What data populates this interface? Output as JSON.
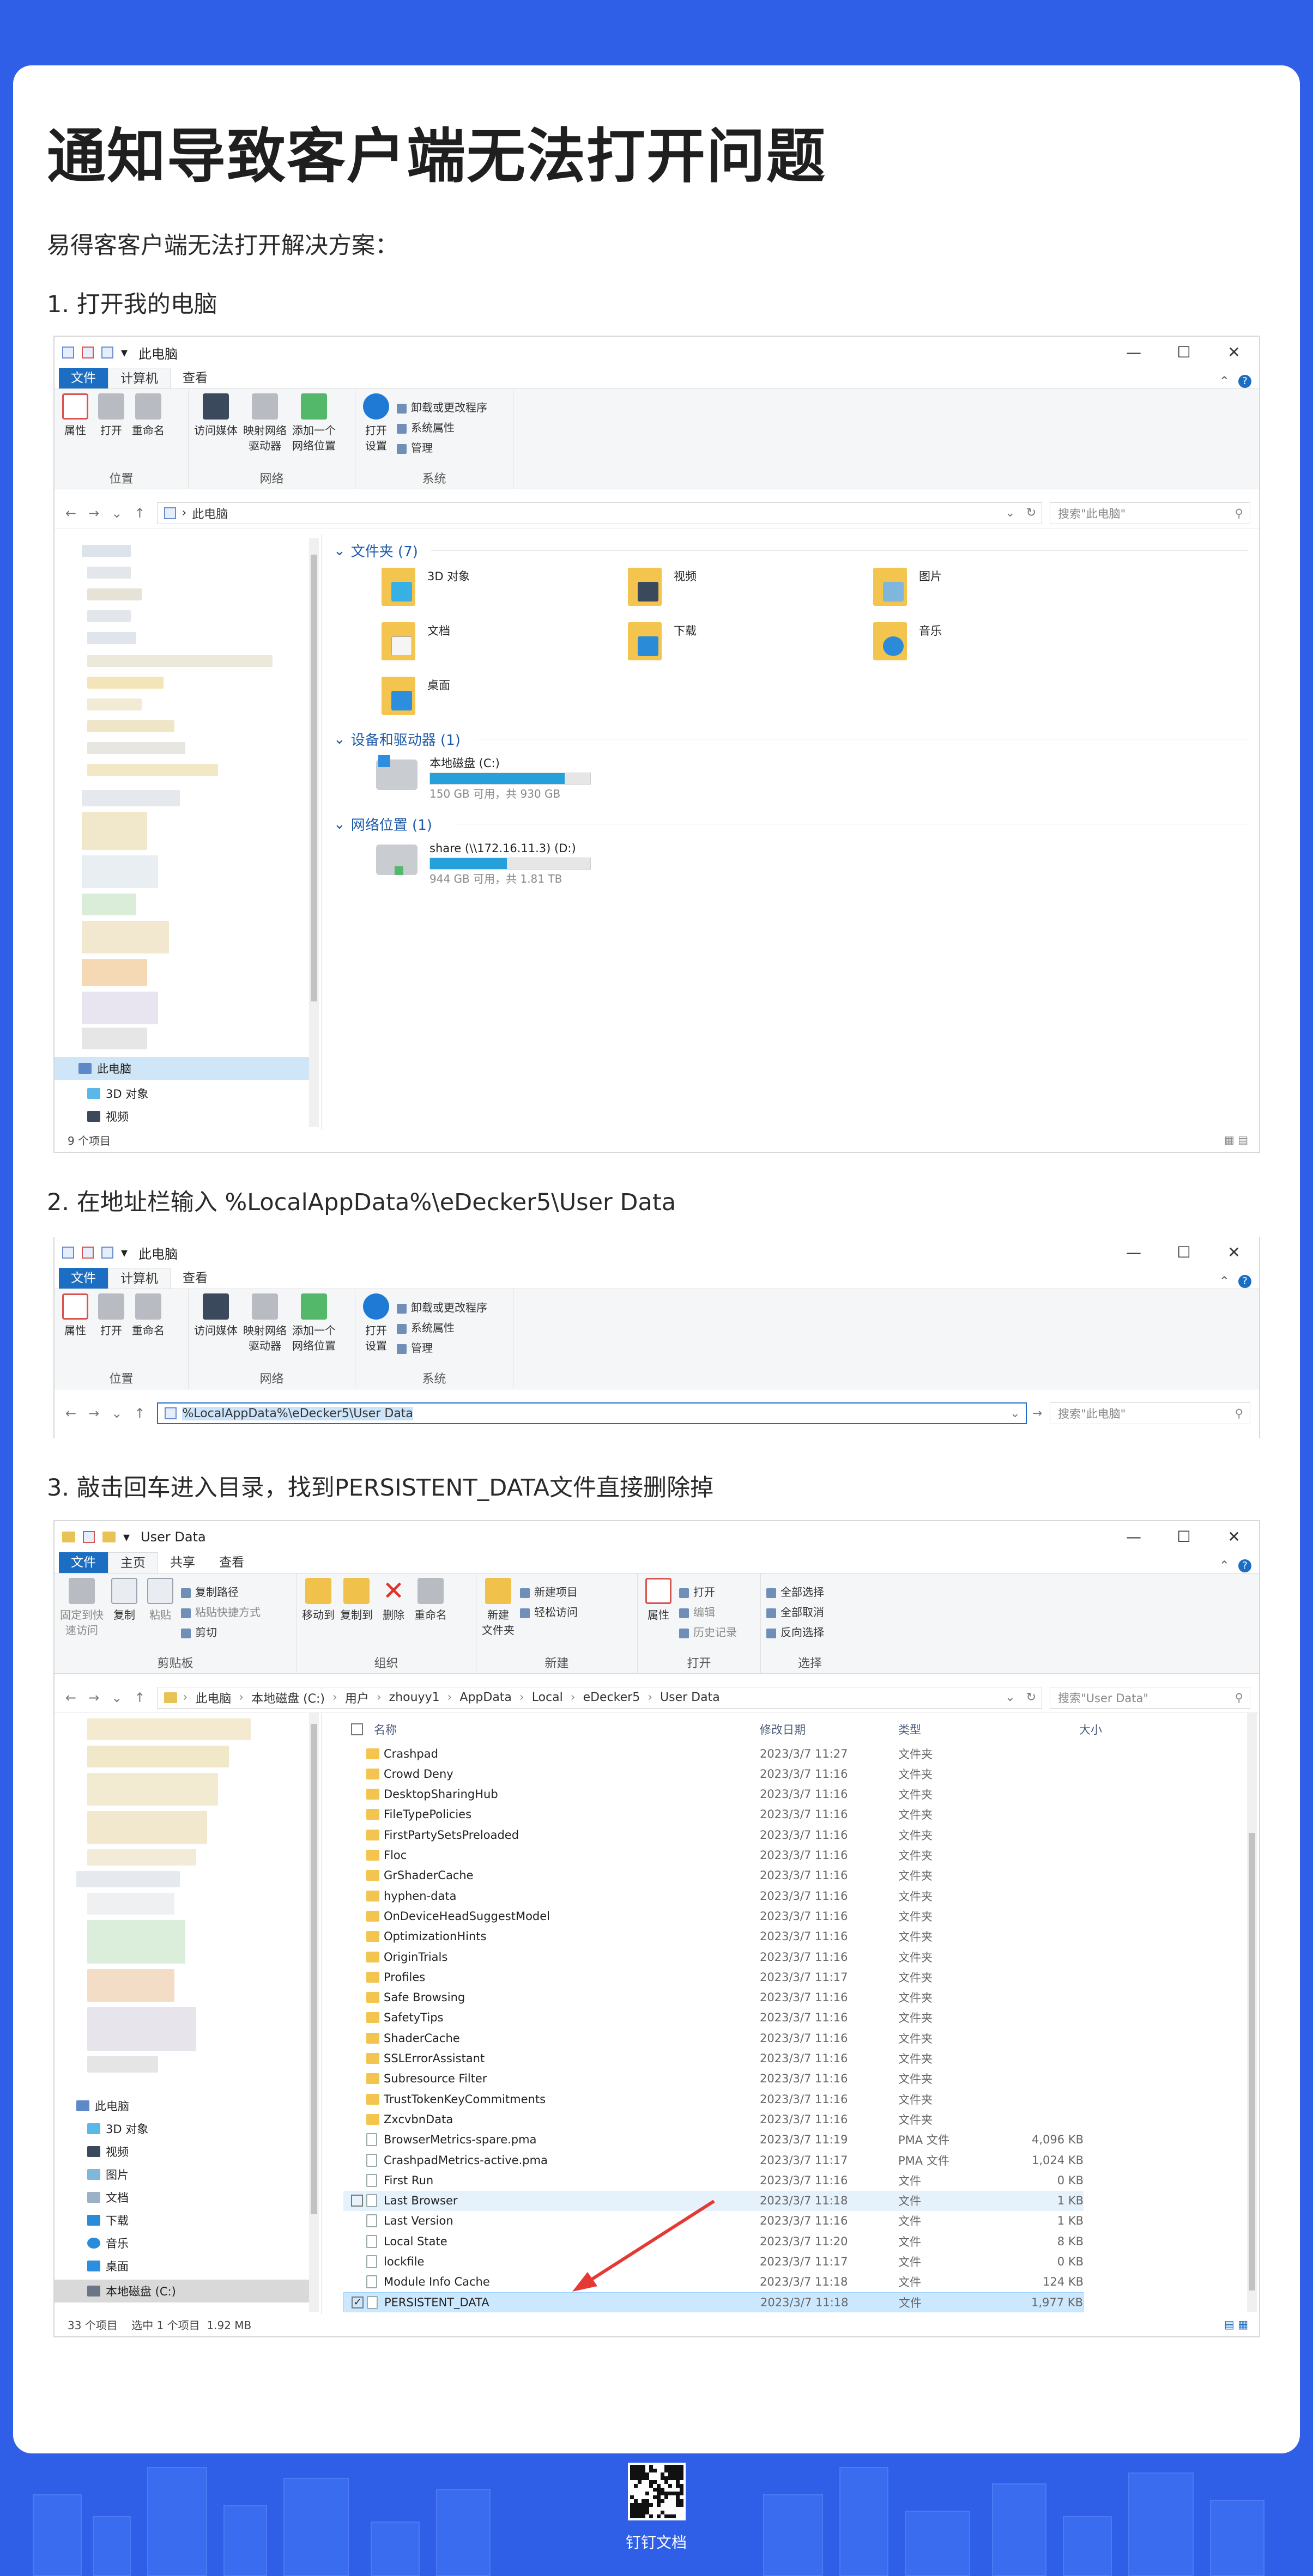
{
  "title": "通知导致客户端无法打开问题",
  "intro": "易得客客户端无法打开解决方案：",
  "steps": [
    "1.  打开我的电脑",
    "2.  在地址栏输入 %LocalAppData%\\eDecker5\\User Data",
    "3.  敲击回车进入目录，找到PERSISTENT_DATA文件直接删除掉"
  ],
  "win1": {
    "title": "此电脑",
    "tabs": [
      "文件",
      "计算机",
      "查看"
    ],
    "groups": {
      "location": "位置",
      "network": "网络",
      "system": "系统"
    },
    "btn_props": "属性",
    "btn_open": "打开",
    "btn_rename": "重命名",
    "btn_media": "访问媒体",
    "btn_map1": "映射网络",
    "btn_map2": "驱动器",
    "btn_add1": "添加一个",
    "btn_add2": "网络位置",
    "btn_openset1": "打开",
    "btn_openset2": "设置",
    "sys_items": [
      "卸载或更改程序",
      "系统属性",
      "管理"
    ],
    "path": "此电脑",
    "search": "搜索\"此电脑\"",
    "folders_head": "文件夹 (7)",
    "folders": [
      "3D 对象",
      "视频",
      "图片",
      "文档",
      "下载",
      "音乐",
      "桌面"
    ],
    "devices_head": "设备和驱动器 (1)",
    "drive_c": {
      "name": "本地磁盘 (C:)",
      "free": "150 GB 可用，共 930 GB",
      "used": 0.84
    },
    "network_head": "网络位置 (1)",
    "drive_d": {
      "name": "share (\\\\172.16.11.3) (D:)",
      "free": "944 GB 可用，共 1.81 TB",
      "used": 0.48
    },
    "side": [
      "此电脑",
      "3D 对象",
      "视频"
    ],
    "status": "9 个项目"
  },
  "win2": {
    "title": "此电脑",
    "tabs": [
      "文件",
      "计算机",
      "查看"
    ],
    "groups": {
      "location": "位置",
      "network": "网络",
      "system": "系统"
    },
    "btn_props": "属性",
    "btn_open": "打开",
    "btn_rename": "重命名",
    "btn_media": "访问媒体",
    "btn_map1": "映射网络",
    "btn_map2": "驱动器",
    "btn_add1": "添加一个",
    "btn_add2": "网络位置",
    "btn_openset1": "打开",
    "btn_openset2": "设置",
    "sys_items": [
      "卸载或更改程序",
      "系统属性",
      "管理"
    ],
    "address": "%LocalAppData%\\eDecker5\\User Data",
    "search": "搜索\"此电脑\""
  },
  "win3": {
    "title": "User Data",
    "tabs": [
      "文件",
      "主页",
      "共享",
      "查看"
    ],
    "btn_pin1": "固定到快",
    "btn_pin2": "速访问",
    "btn_copy": "复制",
    "btn_paste": "粘贴",
    "clip_items": [
      "复制路径",
      "粘贴快捷方式",
      "剪切"
    ],
    "btn_moveto": "移动到",
    "btn_copyto": "复制到",
    "btn_delete": "删除",
    "btn_rename": "重命名",
    "btn_newfolder1": "新建",
    "btn_newfolder2": "文件夹",
    "new_items": [
      "新建项目",
      "轻松访问"
    ],
    "btn_props": "属性",
    "open_items": [
      "打开",
      "编辑",
      "历史记录"
    ],
    "select_items": [
      "全部选择",
      "全部取消",
      "反向选择"
    ],
    "groups": {
      "clipboard": "剪贴板",
      "organize": "组织",
      "new": "新建",
      "open": "打开",
      "select": "选择"
    },
    "crumbs": [
      "此电脑",
      "本地磁盘 (C:)",
      "用户",
      "zhouyy1",
      "AppData",
      "Local",
      "eDecker5",
      "User Data"
    ],
    "search": "搜索\"User Data\"",
    "cols": [
      "名称",
      "修改日期",
      "类型",
      "大小"
    ],
    "rows": [
      {
        "name": "Crashpad",
        "date": "2023/3/7 11:27",
        "type": "文件夹",
        "size": "",
        "kind": "folder"
      },
      {
        "name": "Crowd Deny",
        "date": "2023/3/7 11:16",
        "type": "文件夹",
        "size": "",
        "kind": "folder"
      },
      {
        "name": "DesktopSharingHub",
        "date": "2023/3/7 11:16",
        "type": "文件夹",
        "size": "",
        "kind": "folder"
      },
      {
        "name": "FileTypePolicies",
        "date": "2023/3/7 11:16",
        "type": "文件夹",
        "size": "",
        "kind": "folder"
      },
      {
        "name": "FirstPartySetsPreloaded",
        "date": "2023/3/7 11:16",
        "type": "文件夹",
        "size": "",
        "kind": "folder"
      },
      {
        "name": "Floc",
        "date": "2023/3/7 11:16",
        "type": "文件夹",
        "size": "",
        "kind": "folder"
      },
      {
        "name": "GrShaderCache",
        "date": "2023/3/7 11:16",
        "type": "文件夹",
        "size": "",
        "kind": "folder"
      },
      {
        "name": "hyphen-data",
        "date": "2023/3/7 11:16",
        "type": "文件夹",
        "size": "",
        "kind": "folder"
      },
      {
        "name": "OnDeviceHeadSuggestModel",
        "date": "2023/3/7 11:16",
        "type": "文件夹",
        "size": "",
        "kind": "folder"
      },
      {
        "name": "OptimizationHints",
        "date": "2023/3/7 11:16",
        "type": "文件夹",
        "size": "",
        "kind": "folder"
      },
      {
        "name": "OriginTrials",
        "date": "2023/3/7 11:16",
        "type": "文件夹",
        "size": "",
        "kind": "folder"
      },
      {
        "name": "Profiles",
        "date": "2023/3/7 11:17",
        "type": "文件夹",
        "size": "",
        "kind": "folder"
      },
      {
        "name": "Safe Browsing",
        "date": "2023/3/7 11:16",
        "type": "文件夹",
        "size": "",
        "kind": "folder"
      },
      {
        "name": "SafetyTips",
        "date": "2023/3/7 11:16",
        "type": "文件夹",
        "size": "",
        "kind": "folder"
      },
      {
        "name": "ShaderCache",
        "date": "2023/3/7 11:16",
        "type": "文件夹",
        "size": "",
        "kind": "folder"
      },
      {
        "name": "SSLErrorAssistant",
        "date": "2023/3/7 11:16",
        "type": "文件夹",
        "size": "",
        "kind": "folder"
      },
      {
        "name": "Subresource Filter",
        "date": "2023/3/7 11:16",
        "type": "文件夹",
        "size": "",
        "kind": "folder"
      },
      {
        "name": "TrustTokenKeyCommitments",
        "date": "2023/3/7 11:16",
        "type": "文件夹",
        "size": "",
        "kind": "folder"
      },
      {
        "name": "ZxcvbnData",
        "date": "2023/3/7 11:16",
        "type": "文件夹",
        "size": "",
        "kind": "folder"
      },
      {
        "name": "BrowserMetrics-spare.pma",
        "date": "2023/3/7 11:19",
        "type": "PMA 文件",
        "size": "4,096 KB",
        "kind": "doc"
      },
      {
        "name": "CrashpadMetrics-active.pma",
        "date": "2023/3/7 11:17",
        "type": "PMA 文件",
        "size": "1,024 KB",
        "kind": "doc"
      },
      {
        "name": "First Run",
        "date": "2023/3/7 11:16",
        "type": "文件",
        "size": "0 KB",
        "kind": "doc"
      },
      {
        "name": "Last Browser",
        "date": "2023/3/7 11:18",
        "type": "文件",
        "size": "1 KB",
        "kind": "doc"
      },
      {
        "name": "Last Version",
        "date": "2023/3/7 11:16",
        "type": "文件",
        "size": "1 KB",
        "kind": "doc"
      },
      {
        "name": "Local State",
        "date": "2023/3/7 11:20",
        "type": "文件",
        "size": "8 KB",
        "kind": "doc"
      },
      {
        "name": "lockfile",
        "date": "2023/3/7 11:17",
        "type": "文件",
        "size": "0 KB",
        "kind": "doc"
      },
      {
        "name": "Module Info Cache",
        "date": "2023/3/7 11:18",
        "type": "文件",
        "size": "124 KB",
        "kind": "doc"
      },
      {
        "name": "PERSISTENT_DATA",
        "date": "2023/3/7 11:18",
        "type": "文件",
        "size": "1,977 KB",
        "kind": "doc"
      }
    ],
    "side": [
      "此电脑",
      "3D 对象",
      "视频",
      "图片",
      "文档",
      "下载",
      "音乐",
      "桌面",
      "本地磁盘 (C:)"
    ],
    "status": "33 个项目    选中 1 个项目  1.92 MB"
  },
  "footer": {
    "label": "钉钉文档"
  },
  "colors": {
    "background": "#2e5fe6",
    "accent": "#1b6ec2",
    "arrow": "#e53935"
  }
}
